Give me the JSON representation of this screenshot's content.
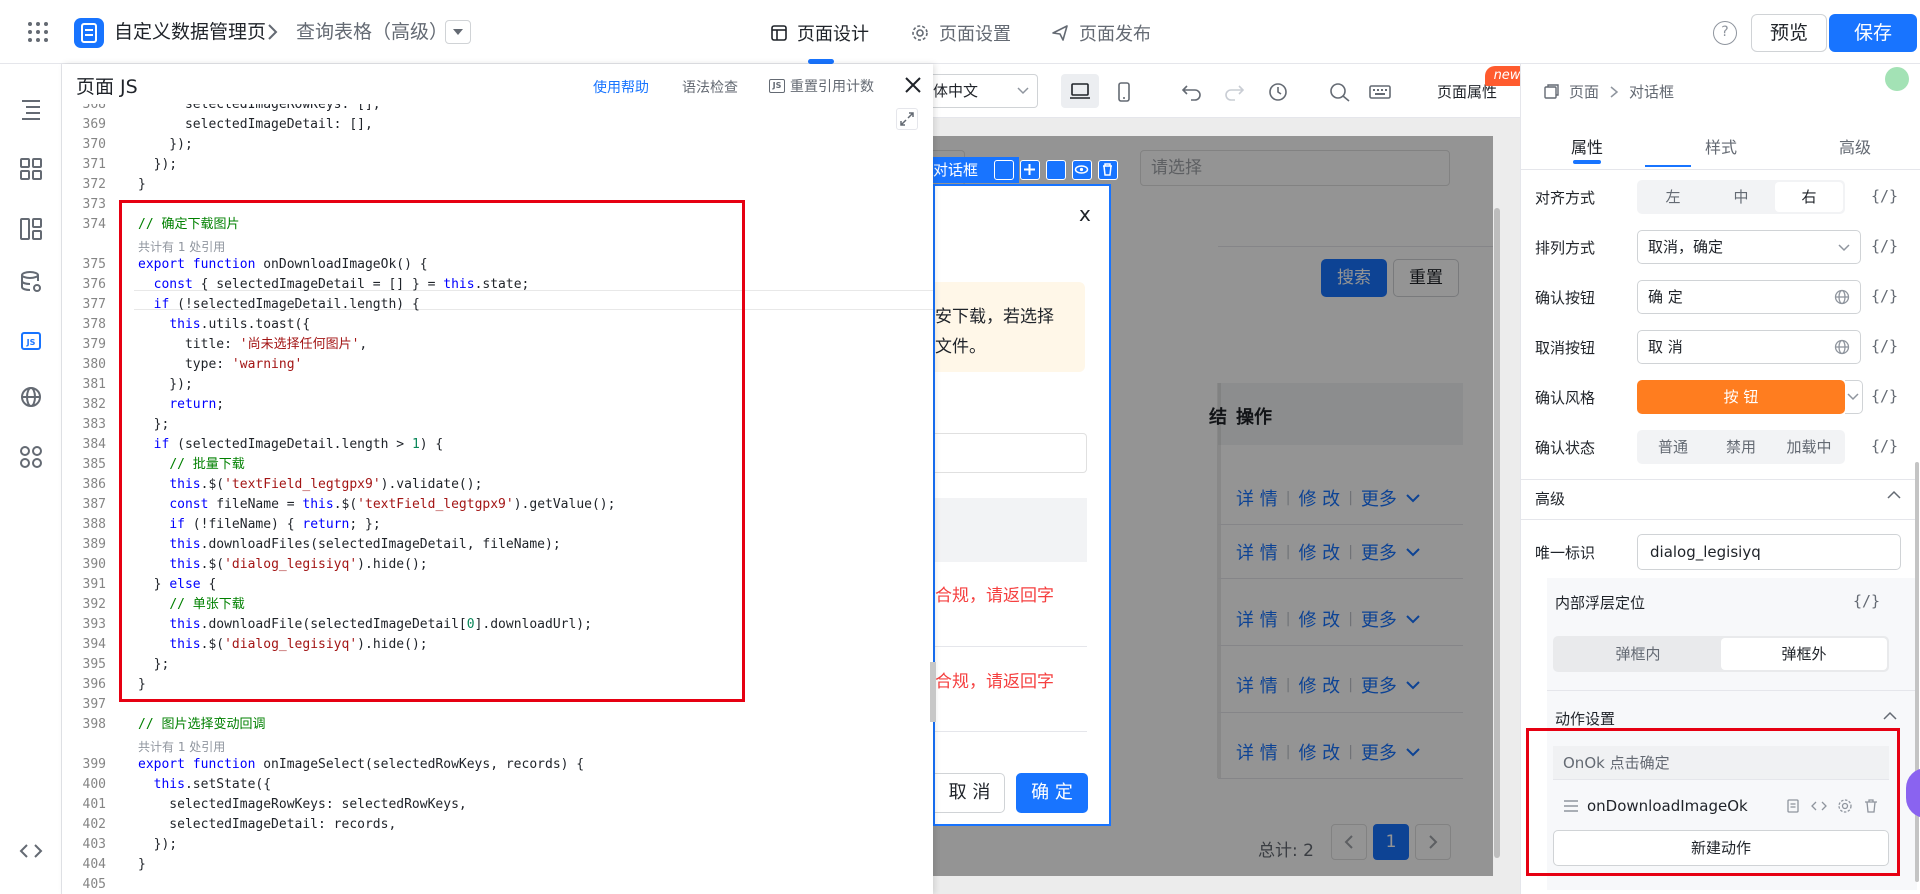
{
  "header": {
    "app_name": "自定义数据管理页",
    "page_name": "查询表格（高级）",
    "nav": [
      {
        "label": "页面设计",
        "icon": "layout-icon",
        "active": true
      },
      {
        "label": "页面设置",
        "icon": "gear-icon",
        "active": false
      },
      {
        "label": "页面发布",
        "icon": "send-icon",
        "active": false
      }
    ],
    "help": "?",
    "preview": "预览",
    "save": "保存",
    "accent": "#1874ff"
  },
  "left_rail": [
    "outline-icon",
    "components-icon",
    "layout-panel-icon",
    "datasource-icon",
    "js-icon",
    "globe-icon",
    "plugins-icon",
    "code-icon"
  ],
  "code_panel": {
    "title": "页面 JS",
    "help_link": "使用帮助",
    "lint_link": "语法检查",
    "js_badge": "JS",
    "reset_link": "重置引用计数",
    "ref_hint": "共计有 1 处引用"
  },
  "canvas": {
    "lang_select": "体中文",
    "page_prop": "页面属性",
    "new_badge": "new",
    "select_placeholder": "请选择",
    "search": "搜索",
    "reset": "重置",
    "col_jie": "结",
    "col_op": "操作",
    "actions": {
      "detail": "详 情",
      "edit": "修 改",
      "more": "更多"
    },
    "total": "总计: 2",
    "page": "1"
  },
  "dialog": {
    "tag": "对话框",
    "close": "x",
    "warn_l1": "安下载，若选择",
    "warn_l2": "文件。",
    "err": "合规，请返回字",
    "cancel": "取 消",
    "ok": "确 定"
  },
  "right_panel": {
    "bc_page": "页面",
    "bc_dialog": "对话框",
    "tabs": [
      "属性",
      "样式",
      "高级"
    ],
    "fx": "{/}",
    "align_label": "对齐方式",
    "align_opts": [
      "左",
      "中",
      "右"
    ],
    "order_label": "排列方式",
    "order_value": "取消，确定",
    "confirm_label": "确认按钮",
    "confirm_value": "确 定",
    "cancel_label": "取消按钮",
    "cancel_value": "取 消",
    "style_label": "确认风格",
    "style_value": "按 钮",
    "state_label": "确认状态",
    "state_opts": [
      "普通",
      "禁用",
      "加载中"
    ],
    "advanced": "高级",
    "unique_label": "唯一标识",
    "unique_value": "dialog_legisiyq",
    "layer_label": "内部浮层定位",
    "layer_opts": [
      "弹框内",
      "弹框外"
    ],
    "action_label": "动作设置",
    "event": "OnOk 点击确定",
    "handler": "onDownloadImageOk",
    "new_action": "新建动作"
  }
}
